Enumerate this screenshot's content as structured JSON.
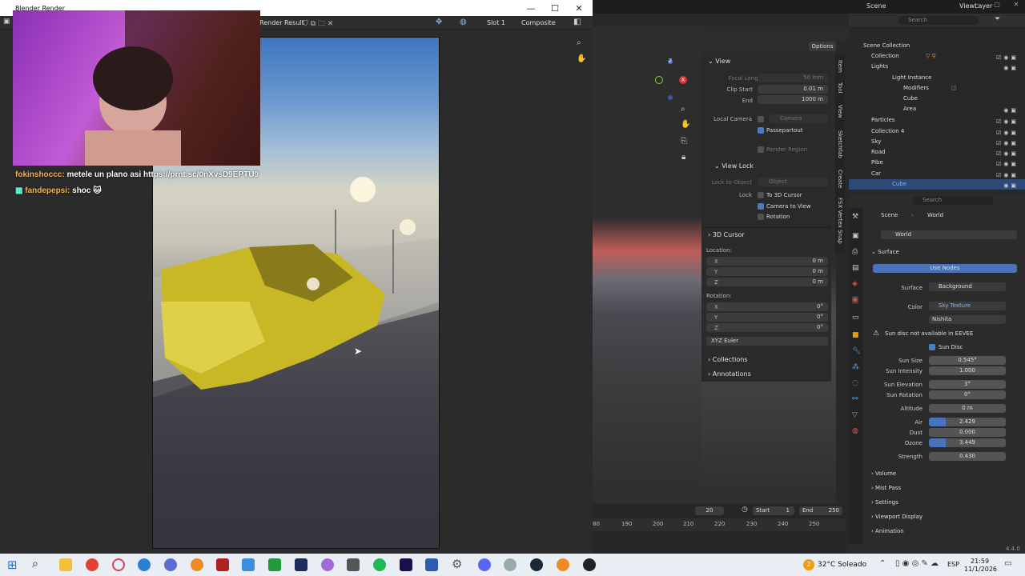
{
  "render_window": {
    "title": "Blender Render",
    "header": {
      "image_name": "Render Result",
      "slot": "Slot 1",
      "pass": "Composite"
    }
  },
  "chat": [
    {
      "user": "fokinshoccc:",
      "message": "metele un plano asi https://prnt.sc/0nXvsD9EPTU9"
    },
    {
      "user": "fandepepsi:",
      "message": "shoc"
    }
  ],
  "blender": {
    "topbar": {
      "scene": "Scene",
      "view_layer": "ViewLayer"
    },
    "viewport": {
      "options": "Options"
    },
    "npanel": {
      "view_title": "View",
      "focal_length_label": "Focal Length",
      "focal_length": "50 mm",
      "clip_start_label": "Clip Start",
      "clip_start": "0.01 m",
      "end_label": "End",
      "end": "1000 m",
      "local_camera_label": "Local Camera",
      "camera": "Camera",
      "passepartout": "Passepartout",
      "render_region": "Render Region",
      "view_lock_title": "View Lock",
      "lock_to_object_label": "Lock to Object",
      "object": "Object",
      "lock_label": "Lock",
      "to_3d_cursor": "To 3D Cursor",
      "camera_to_view": "Camera to View",
      "rotation_opt": "Rotation",
      "cursor_title": "3D Cursor",
      "location_label": "Location:",
      "x": "X",
      "y": "Y",
      "z": "Z",
      "loc_x": "0 m",
      "loc_y": "0 m",
      "loc_z": "0 m",
      "rotation_label": "Rotation:",
      "rot_x": "0°",
      "rot_y": "0°",
      "rot_z": "0°",
      "euler": "XYZ Euler",
      "collections": "Collections",
      "annotations": "Annotations"
    },
    "vtabs": [
      "Item",
      "Tool",
      "View",
      "Sketchfab",
      "Create",
      "FSX Vertex Snap"
    ],
    "timeline": {
      "frame": "20",
      "start_label": "Start",
      "start": "1",
      "end_label": "End",
      "end": "250",
      "ticks": [
        "80",
        "190",
        "200",
        "210",
        "220",
        "230",
        "240",
        "250"
      ]
    },
    "outliner": {
      "search": "Search",
      "rows": [
        "Scene Collection",
        "Collection",
        "Lights",
        "Light Instance",
        "Modifiers",
        "Cube",
        "Area",
        "Particles",
        "Collection 4",
        "Sky",
        "Road",
        "Pibe",
        "Car",
        "Cube"
      ]
    },
    "properties": {
      "search": "Search",
      "breadcrumb_scene": "Scene",
      "breadcrumb_world": "World",
      "world_name": "World",
      "surface_title": "Surface",
      "use_nodes": "Use Nodes",
      "surface_label": "Surface",
      "surface_val": "Background",
      "color_label": "Color",
      "color_val": "Sky Texture",
      "sky_type": "Nishita",
      "warning": "Sun disc not available in EEVEE",
      "sun_disc": "Sun Disc",
      "sun_size_label": "Sun Size",
      "sun_size": "0.545°",
      "sun_intensity_label": "Sun Intensity",
      "sun_intensity": "1.000",
      "sun_elevation_label": "Sun Elevation",
      "sun_elevation": "3°",
      "sun_rotation_label": "Sun Rotation",
      "sun_rotation": "0°",
      "altitude_label": "Altitude",
      "altitude": "0 m",
      "air_label": "Air",
      "air": "2.429",
      "dust_label": "Dust",
      "dust": "0.000",
      "ozone_label": "Ozone",
      "ozone": "3.449",
      "strength_label": "Strength",
      "strength": "0.430",
      "volume": "Volume",
      "mist_pass": "Mist Pass",
      "settings": "Settings",
      "viewport_display": "Viewport Display",
      "animation": "Animation"
    },
    "version": "4.4.0"
  },
  "taskbar": {
    "weather": "32°C Soleado",
    "lang": "ESP",
    "time": "21:59",
    "date": "11/1/2026",
    "weather_badge": "2"
  }
}
